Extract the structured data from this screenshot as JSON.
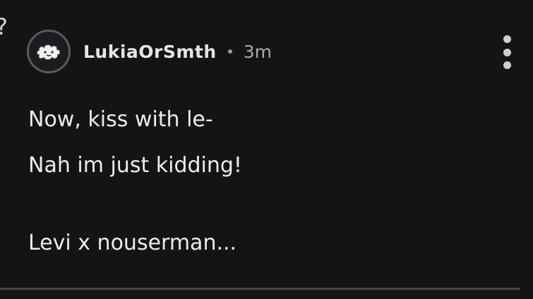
{
  "post": {
    "author": "LukiaOrSmth",
    "time_ago": "3m",
    "lines": [
      "Now, kiss with le-",
      "Nah im just kidding!",
      "Levi x nouserman..."
    ]
  },
  "icons": {
    "avatar": "fluffy-cloud-avatar",
    "menu": "more-vertical-icon",
    "left_fragment": "question-mark-icon"
  },
  "colors": {
    "background": "#141417",
    "text": "#ececec",
    "muted": "#a9a9ae",
    "divider": "#46464b"
  }
}
